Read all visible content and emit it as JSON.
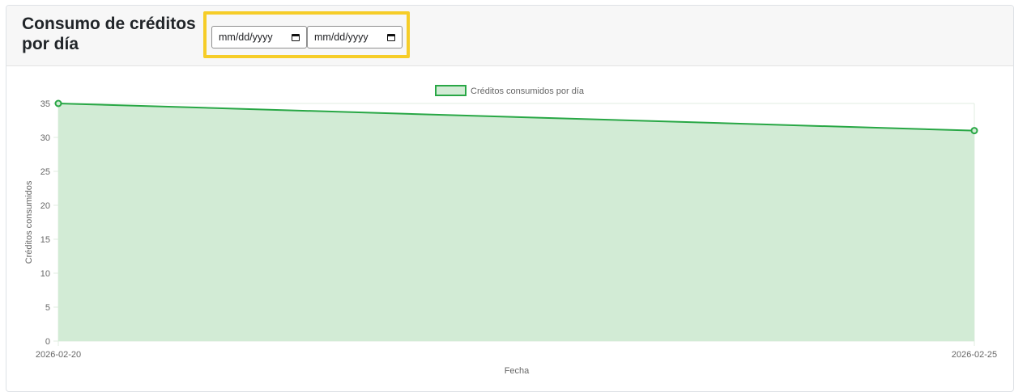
{
  "header": {
    "title": "Consumo de créditos por día"
  },
  "filters": {
    "date_from": {
      "placeholder": "mm/dd/yyyy",
      "icon": "calendar-icon"
    },
    "date_to": {
      "placeholder": "mm/dd/yyyy",
      "icon": "calendar-icon"
    }
  },
  "colors": {
    "line": "#28a745",
    "fill": "#d2ebd5",
    "grid": "#e0ece1",
    "highlight": "#f6cd28"
  },
  "chart_data": {
    "type": "area",
    "x": [
      "2026-02-20",
      "2026-02-25"
    ],
    "series": [
      {
        "name": "Créditos consumidos por día",
        "values": [
          35,
          31
        ]
      }
    ],
    "xlabel": "Fecha",
    "ylabel": "Créditos consumidos",
    "ylim": [
      0,
      35
    ],
    "yticks": [
      0,
      5,
      10,
      15,
      20,
      25,
      30,
      35
    ],
    "grid": true,
    "legend": "top-center"
  }
}
